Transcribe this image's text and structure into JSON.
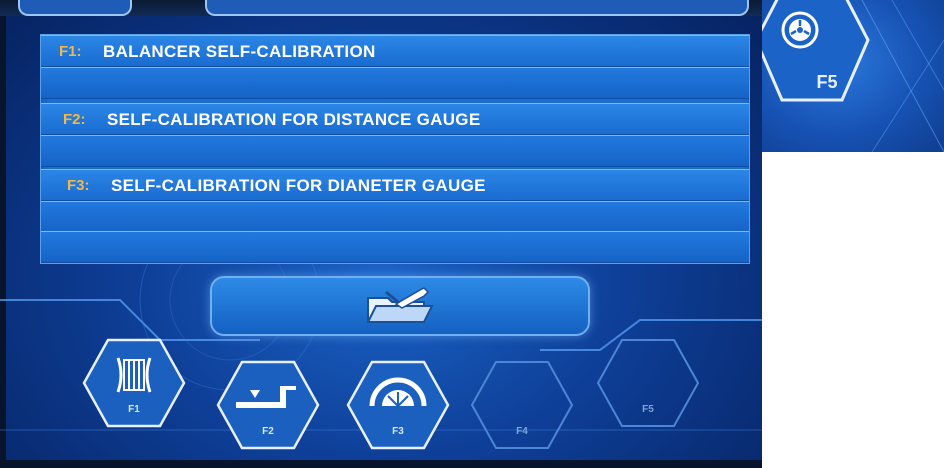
{
  "menu": {
    "items": [
      {
        "key": "F1:",
        "label": "BALANCER SELF-CALIBRATION"
      },
      {
        "key": "F2:",
        "label": "SELF-CALIBRATION FOR DISTANCE GAUGE"
      },
      {
        "key": "F3:",
        "label": "SELF-CALIBRATION FOR DIANETER GAUGE"
      }
    ]
  },
  "toolbar": {
    "tool_icon": "folder-wrench-icon"
  },
  "function_keys": [
    {
      "label": "F1",
      "icon": "wheel-profile-icon"
    },
    {
      "label": "F2",
      "icon": "distance-gauge-icon"
    },
    {
      "label": "F3",
      "icon": "diameter-gauge-icon"
    },
    {
      "label": "F4",
      "icon": ""
    },
    {
      "label": "F5",
      "icon": ""
    }
  ],
  "inset": {
    "label": "F5",
    "icon": "wheel-rotate-icon"
  },
  "colors": {
    "key_text": "#f0b84a",
    "row_blue": "#1c6fd1",
    "background": "#0e3f98"
  }
}
